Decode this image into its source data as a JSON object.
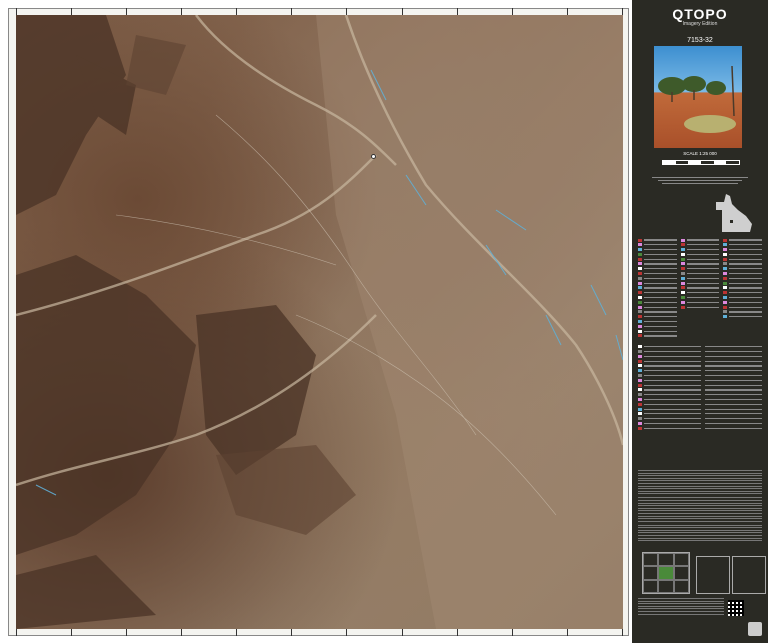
{
  "panel": {
    "title": "QTOPO",
    "edition": "Imagery Edition",
    "sheet_number": "7153-32",
    "scale": "SCALE 1:25 000",
    "colors": {
      "panel_background": "#2a2a24",
      "legend_green": "#4a8a3a",
      "water_blue": "#5fb0d8"
    }
  },
  "map": {
    "description_icon": "satellite-imagery",
    "marker_icon": "location-dot-icon"
  },
  "icons": {
    "photo": "outback-landscape-photo",
    "queensland": "queensland-outline-icon",
    "crest": "queensland-government-crest-icon",
    "qr": "qr-code-icon"
  }
}
